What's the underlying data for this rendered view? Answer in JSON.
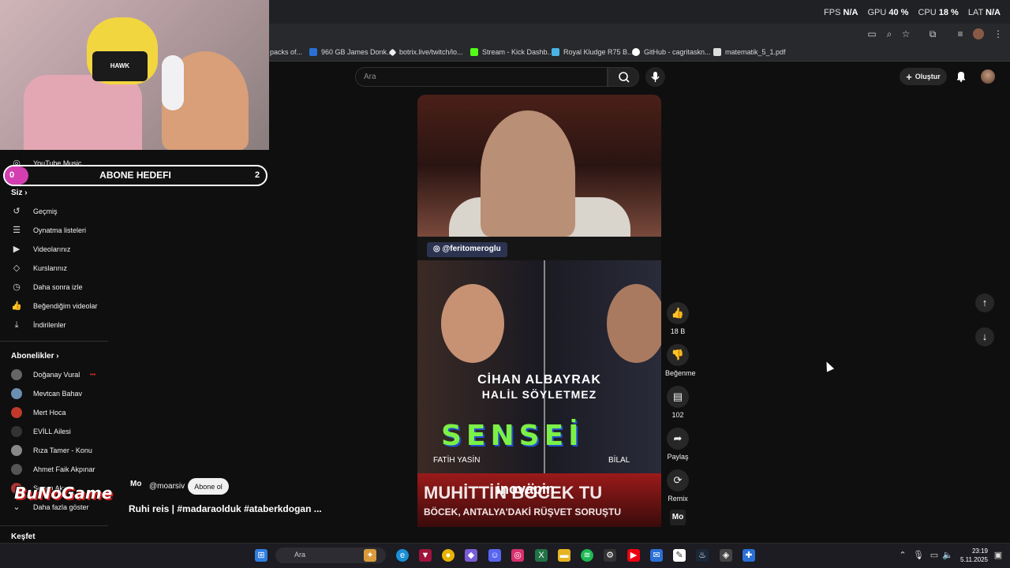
{
  "stats": {
    "fps_label": "FPS",
    "fps_value": "N/A",
    "gpu_label": "GPU",
    "gpu_value": "40 %",
    "cpu_label": "CPU",
    "cpu_value": "18 %",
    "lat_label": "LAT",
    "lat_value": "N/A"
  },
  "bookmarks": [
    {
      "label": "packs of..."
    },
    {
      "label": "960 GB James Donk..."
    },
    {
      "label": "botrix.live/twitch/lo..."
    },
    {
      "label": "Stream - Kick Dashb..."
    },
    {
      "label": "Royal Kludge R75 B..."
    },
    {
      "label": "GitHub - cagritaskn..."
    },
    {
      "label": "matematik_5_1.pdf"
    }
  ],
  "header": {
    "search_placeholder": "Ara",
    "create_label": "Oluştur"
  },
  "webcam": {
    "hat_text": "HAWK"
  },
  "goal": {
    "left": "0",
    "title": "ABONE HEDEFI",
    "right": "2"
  },
  "sidebar": {
    "yt_music": "YouTube Music",
    "you_header": "Siz",
    "you_items": [
      {
        "label": "Geçmiş",
        "icon": "history-icon"
      },
      {
        "label": "Oynatma listeleri",
        "icon": "playlist-icon"
      },
      {
        "label": "Videolarınız",
        "icon": "your-videos-icon"
      },
      {
        "label": "Kurslarınız",
        "icon": "courses-icon"
      },
      {
        "label": "Daha sonra izle",
        "icon": "watch-later-icon"
      },
      {
        "label": "Beğendiğim videolar",
        "icon": "liked-icon"
      },
      {
        "label": "İndirilenler",
        "icon": "download-icon"
      }
    ],
    "subs_header": "Abonelikler",
    "subs": [
      {
        "label": "Doğanay Vural",
        "color": "#666"
      },
      {
        "label": "Mevtcan Bahav",
        "color": "#6b8fb0"
      },
      {
        "label": "Mert Hoca",
        "color": "#c0392b"
      },
      {
        "label": "EVİLL Ailesi",
        "color": "#333"
      },
      {
        "label": "Rıza Tamer - Konu",
        "color": "#888"
      },
      {
        "label": "Ahmet Faik Akpınar",
        "color": "#555"
      },
      {
        "label": "Sezen Aksu",
        "color": "#a33"
      }
    ],
    "show_more": "Daha fazla göster",
    "explore": "Keşfet"
  },
  "video": {
    "tag": "@feritomeroglu",
    "name1": "CİHAN ALBAYRAK",
    "name2": "HALİL SÖYLETMEZ",
    "sensei": "SENSEİ",
    "left_name": "FATİH YASİN",
    "right_name": "BİLAL",
    "headline1": "MUHİTTİN BÖCEK TU",
    "headline2": "BÖCEK, ANTALYA'DAKİ RÜŞVET SORUŞTU",
    "sponsor": "inovapin",
    "channel_logo": "Mo"
  },
  "actions": {
    "like_count": "18 B",
    "dislike_label": "Beğenme",
    "comment_count": "102",
    "share_label": "Paylaş",
    "remix_label": "Remix"
  },
  "info": {
    "channel_logo": "Mo",
    "channel": "@moarsiv",
    "subscribe": "Abone ol",
    "title": "Ruhi reis | #madaraolduk #ataberkdogan ..."
  },
  "overlay": {
    "brand": "BuNoGame"
  },
  "taskbar": {
    "search": "Ara",
    "time": "23:19",
    "date": "5.11.2025"
  }
}
